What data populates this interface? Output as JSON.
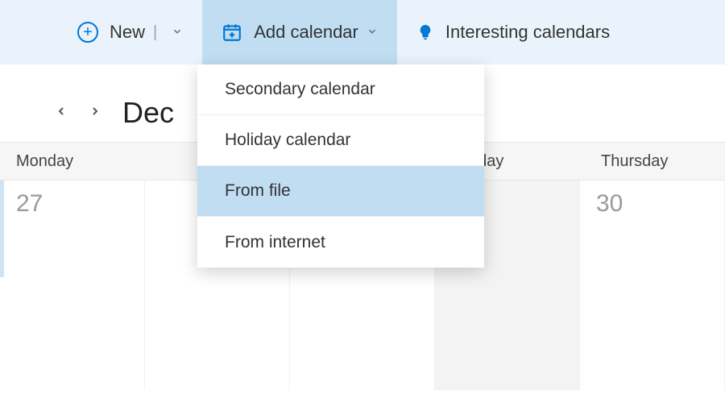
{
  "toolbar": {
    "new_label": "New",
    "add_calendar_label": "Add calendar",
    "interesting_label": "Interesting calendars"
  },
  "dropdown": {
    "items": [
      {
        "label": "Secondary calendar"
      },
      {
        "label": "Holiday calendar"
      },
      {
        "label": "From file"
      },
      {
        "label": "From internet"
      }
    ]
  },
  "nav": {
    "month_title": "Dec"
  },
  "days": {
    "headers": [
      "Monday",
      "",
      "",
      "esday",
      "Thursday"
    ],
    "numbers": [
      "27",
      "",
      "",
      "",
      "30"
    ]
  }
}
